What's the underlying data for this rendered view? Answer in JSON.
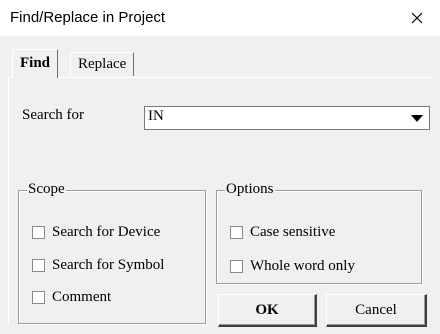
{
  "window": {
    "title": "Find/Replace in Project",
    "close_icon": "close-icon"
  },
  "tabs": [
    {
      "label": "Find",
      "active": true
    },
    {
      "label": "Replace",
      "active": false
    }
  ],
  "search": {
    "label": "Search for",
    "value": "IN"
  },
  "scope": {
    "legend": "Scope",
    "options": [
      {
        "label": "Search for Device",
        "checked": false
      },
      {
        "label": "Search for Symbol",
        "checked": false
      },
      {
        "label": "Comment",
        "checked": false
      }
    ]
  },
  "options": {
    "legend": "Options",
    "items": [
      {
        "label": "Case sensitive",
        "checked": false
      },
      {
        "label": "Whole word only",
        "checked": false
      }
    ]
  },
  "buttons": {
    "ok": "OK",
    "cancel": "Cancel"
  }
}
